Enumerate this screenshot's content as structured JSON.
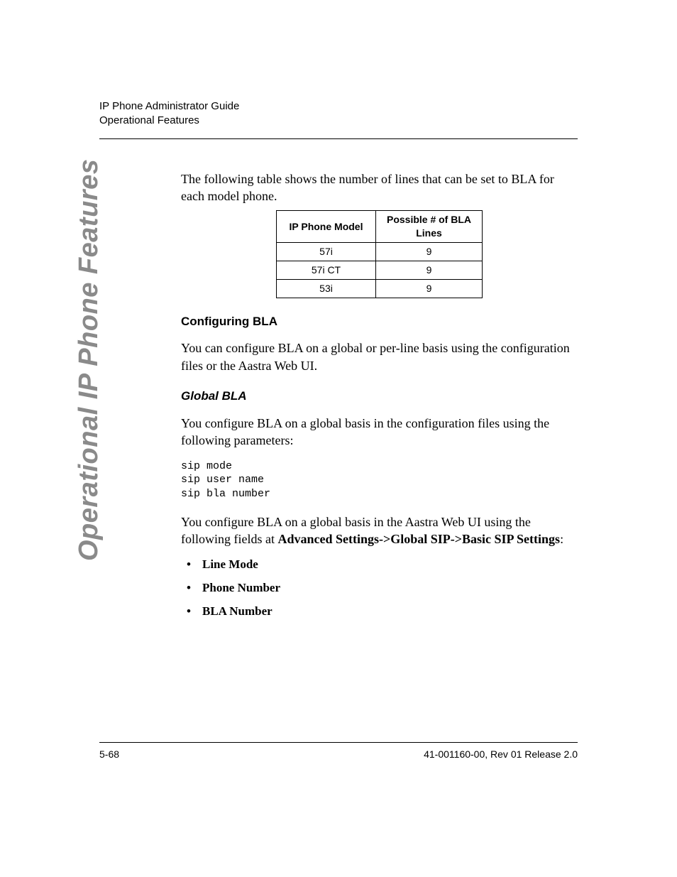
{
  "header": {
    "line1": "IP Phone Administrator Guide",
    "line2": "Operational Features"
  },
  "sidebar": "Operational IP Phone Features",
  "body": {
    "intro": "The following table shows the number of lines that can be set to BLA for each model phone.",
    "table": {
      "headers": {
        "col1": "IP Phone Model",
        "col2": "Possible # of BLA Lines"
      },
      "rows": [
        {
          "model": "57i",
          "lines": "9"
        },
        {
          "model": "57i CT",
          "lines": "9"
        },
        {
          "model": "53i",
          "lines": "9"
        }
      ]
    },
    "h_configuring": "Configuring BLA",
    "p_configuring": "You can configure BLA on a global or per-line basis using the configuration files or the Aastra Web UI.",
    "h_global": "Global BLA",
    "p_global1": "You configure BLA on a global basis in the configuration files using the following parameters:",
    "code": "sip mode\nsip user name\nsip bla number",
    "p_global2_a": "You configure BLA on a global basis in the Aastra Web UI using the following fields at ",
    "p_global2_b": "Advanced Settings->Global SIP->Basic SIP Settings",
    "p_global2_c": ":",
    "bullets": [
      "Line Mode",
      "Phone Number",
      "BLA Number"
    ]
  },
  "footer": {
    "left": "5-68",
    "right": "41-001160-00, Rev 01 Release 2.0"
  }
}
